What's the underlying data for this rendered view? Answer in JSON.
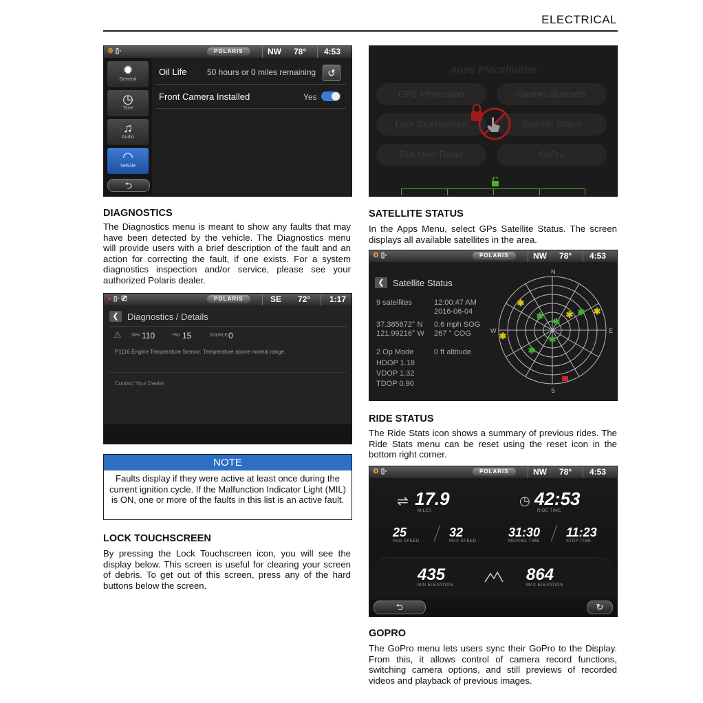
{
  "header": {
    "title": "ELECTRICAL"
  },
  "vehicle_settings": {
    "brand": "POLARIS",
    "direction": "NW",
    "temperature": "78°",
    "time": "4:53",
    "nav": [
      "General",
      "Time",
      "Audio",
      "Vehicle"
    ],
    "oil_life_label": "Oil Life",
    "oil_life_value": "50 hours or 0 miles remaining",
    "front_camera_label": "Front Camera Installed",
    "front_camera_value": "Yes"
  },
  "apps_placeholder": {
    "title": "Apps Placeholder",
    "buttons": [
      "GPS Information",
      "Garmin Bluetooth",
      "Lock Touchscreen",
      "Satellite Status",
      "Roll Over Reset",
      "GoPro"
    ]
  },
  "diagnostics": {
    "heading": "DIAGNOSTICS",
    "text": "The Diagnostics menu is meant to show any faults that may have been detected by the vehicle. The Diagnostics menu will provide users with a brief description of the fault and an action for correcting the fault, if one exists. For a system diagnostics inspection and/or service, please see your authorized Polaris dealer."
  },
  "diag_screen": {
    "brand": "POLARIS",
    "direction": "SE",
    "temperature": "72°",
    "time": "1:17",
    "title": "Diagnostics / Details",
    "spn_label": "SPN",
    "spn_value": "110",
    "fmi_label": "FMI",
    "fmi_value": "15",
    "source_label": "SOURCE",
    "source_value": "0",
    "fault_text": "P1116 Engine Temperature Sensor: Temperature above normal range.",
    "action_text": "Contact Your Dealer"
  },
  "note": {
    "heading": "NOTE",
    "text": "Faults display if they were active at least once during the current ignition cycle. If the Malfunction Indicator Light (MIL) is ON, one or more of the faults in this list is an active fault."
  },
  "lock": {
    "heading": "LOCK TOUCHSCREEN",
    "text": "By pressing the Lock Touchscreen icon, you will see the display below. This screen is useful for clearing your screen of debris. To get out of this screen, press any of the hard buttons below the screen."
  },
  "satellite": {
    "heading": "SATELLITE STATUS",
    "text": "In the Apps Menu, select GPs Satellite Status. The screen displays all available satellites in the area."
  },
  "sat_screen": {
    "brand": "POLARIS",
    "direction": "NW",
    "temperature": "78°",
    "time": "4:53",
    "title": "Satellite Status",
    "sat_count": "9 satellites",
    "time_value": "12:00:47 AM",
    "date_value": "2016-06-04",
    "lat": "37.385672° N",
    "lon": "121.99216° W",
    "speed": "0.6 mph SOG",
    "cog": "267 ° COG",
    "mode": "2 Op Mode",
    "altitude": "0 ft altitude",
    "hdop": "HDOP  1.18",
    "vdop": "VDOP  1.32",
    "tdop": "TDOP  0.90",
    "compass": {
      "n": "N",
      "s": "S",
      "e": "E",
      "w": "W"
    }
  },
  "ride": {
    "heading": "RIDE STATUS",
    "text": "The Ride Stats icon shows a summary of previous rides. The Ride Stats menu can be reset using the reset icon in the bottom right corner."
  },
  "ride_screen": {
    "brand": "POLARIS",
    "direction": "NW",
    "temperature": "78°",
    "time": "4:53",
    "miles": "17.9",
    "miles_label": "MILES",
    "ride_time": "42:53",
    "ride_time_label": "RIDE TIME",
    "avg_speed": "25",
    "avg_speed_label": "AVG SPEED",
    "max_speed": "32",
    "max_speed_label": "MAX SPEED",
    "moving_time": "31:30",
    "moving_time_label": "MOVING TIME",
    "stop_time": "11:23",
    "stop_time_label": "STOP TIME",
    "min_elev": "435",
    "min_elev_label": "MIN ELEVATION",
    "max_elev": "864",
    "max_elev_label": "MAX ELEVATION"
  },
  "gopro": {
    "heading": "GOPRO",
    "text": "The GoPro menu lets users sync their GoPro to the Display. From this, it allows control of camera record functions, switching camera options, and still previews of recorded videos and playback of previous images."
  },
  "colors": {
    "accent": "#2c6fc4",
    "sat_yellow": "#d8c21a",
    "sat_green": "#3fb02f",
    "sat_red": "#d0252a"
  }
}
